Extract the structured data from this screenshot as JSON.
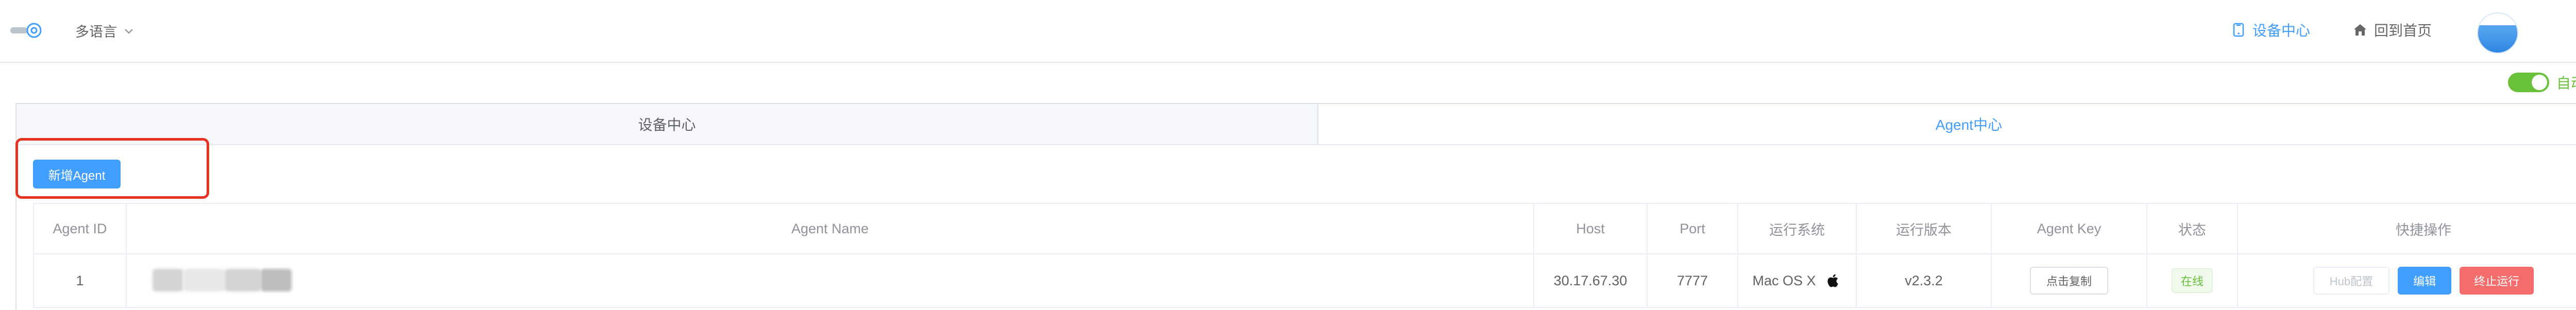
{
  "header": {
    "language_label": "多语言",
    "nav_device_center": "设备中心",
    "nav_home": "回到首页"
  },
  "auto_refresh": {
    "label": "自动刷新",
    "enabled": true
  },
  "tabs": [
    {
      "label": "设备中心",
      "active": false
    },
    {
      "label": "Agent中心",
      "active": true
    }
  ],
  "toolbar": {
    "add_agent_label": "新增Agent"
  },
  "table": {
    "columns": [
      "Agent ID",
      "Agent Name",
      "Host",
      "Port",
      "运行系统",
      "运行版本",
      "Agent Key",
      "状态",
      "快捷操作"
    ],
    "rows": [
      {
        "id": "1",
        "name": "",
        "host": "30.17.67.30",
        "port": "7777",
        "os": "Mac OS X",
        "os_icon": "apple-icon",
        "version": "v2.3.2",
        "key_button": "点击复制",
        "status": "在线",
        "actions": {
          "hub": "Hub配置",
          "edit": "编辑",
          "stop": "终止运行"
        }
      }
    ]
  },
  "colors": {
    "accent": "#409eff",
    "success": "#67c23a",
    "danger": "#f56c6c",
    "highlight": "#e8321f"
  }
}
